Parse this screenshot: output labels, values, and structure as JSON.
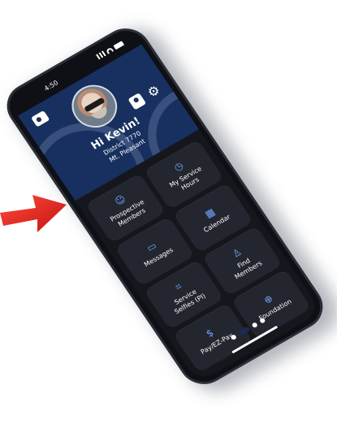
{
  "status_bar": {
    "time": "4:50"
  },
  "header": {
    "greeting": "Hi Kevin!",
    "district": "District 7770",
    "club": "Mt. Pleasant"
  },
  "icons": {
    "contact": "contact-card-icon",
    "profile": "profile-icon",
    "settings": "gear-icon"
  },
  "tiles": [
    {
      "label": "Prospective\nMembers",
      "icon": "people-icon"
    },
    {
      "label": "My Service\nHours",
      "icon": "clock-icon"
    },
    {
      "label": "Messages",
      "icon": "chat-icon"
    },
    {
      "label": "Calendar",
      "icon": "calendar-icon"
    },
    {
      "label": "Service\nSelfies (PI)",
      "icon": "camera-icon"
    },
    {
      "label": "Find\nMembers",
      "icon": "search-person-icon"
    },
    {
      "label": "Pay/EZ-Pay",
      "icon": "dollar-icon"
    },
    {
      "label": "Foundation",
      "icon": "globe-icon"
    }
  ],
  "pager": {
    "pages": 4,
    "active_index": 1
  },
  "colors": {
    "header_bg": "#17305f",
    "accent_icon": "#6ea7ff",
    "tile_bg": "#23262e",
    "arrow": "#e0201c"
  }
}
